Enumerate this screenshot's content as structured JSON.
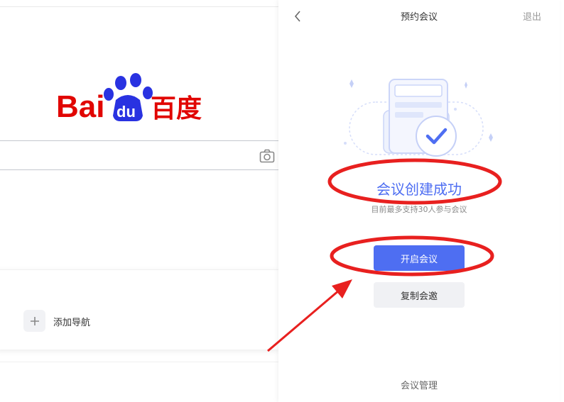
{
  "baidu": {
    "logo_text_latin_1": "Bai",
    "logo_text_paw": "du",
    "logo_text_cn": "百度",
    "add_nav_label": "添加导航"
  },
  "panel": {
    "title": "预约会议",
    "exit_label": "退出",
    "success_title": "会议创建成功",
    "success_subtitle": "目前最多支持30人参与会议",
    "start_button": "开启会议",
    "copy_invite_button": "复制会邀",
    "manage_link": "会议管理"
  },
  "colors": {
    "accent": "#4e6ef2",
    "baidu_red": "#e10602",
    "baidu_blue": "#2932e1",
    "annotation_red": "#e8201f"
  }
}
